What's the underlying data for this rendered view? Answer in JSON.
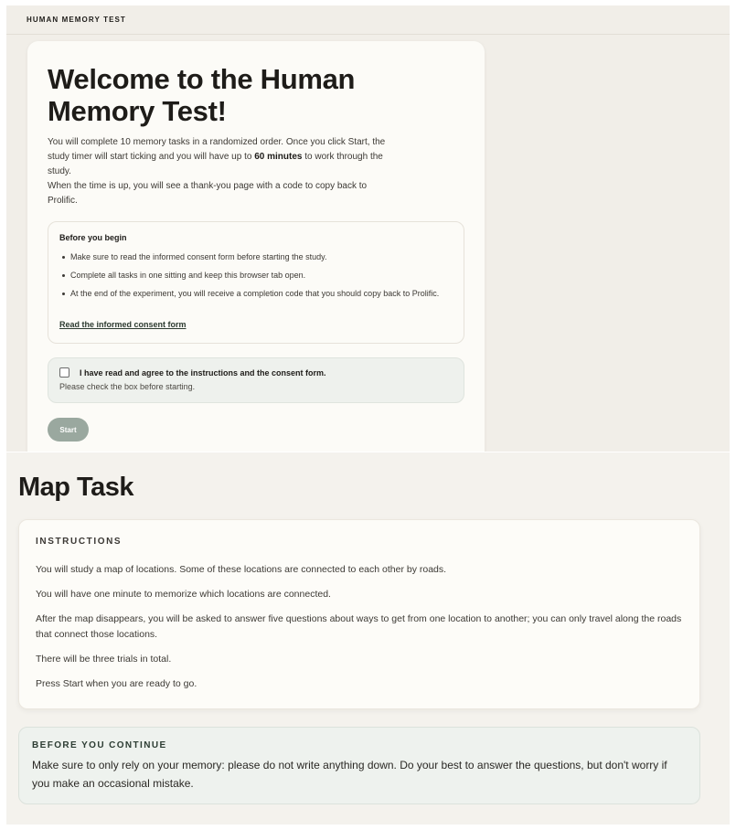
{
  "header": {
    "app_title": "HUMAN MEMORY TEST"
  },
  "welcome": {
    "title": "Welcome to the Human Memory Test!",
    "intro_line1_pre": "You will complete 10 memory tasks in a randomized order. Once you click Start, the study timer will start ticking and you will have up to ",
    "intro_line1_bold": "60 minutes",
    "intro_line1_post": " to work through the study.",
    "intro_line2": "When the time is up, you will see a thank-you page with a code to copy back to Prolific.",
    "before_begin": {
      "heading": "Before you begin",
      "items": [
        "Make sure to read the informed consent form before starting the study.",
        "Complete all tasks in one sitting and keep this browser tab open.",
        "At the end of the experiment, you will receive a completion code that you should copy back to Prolific."
      ],
      "link": "Read the informed consent form"
    },
    "agreement": {
      "label": "I have read and agree to the instructions and the consent form.",
      "hint": "Please check the box before starting.",
      "checked": false
    },
    "start_button": "Start",
    "start_button_color": "#9aa89f"
  },
  "map_task": {
    "title": "Map Task",
    "instructions": {
      "heading": "INSTRUCTIONS",
      "paragraphs": [
        "You will study a map of locations. Some of these locations are connected to each other by roads.",
        "You will have one minute to memorize which locations are connected.",
        "After the map disappears, you will be asked to answer five questions about ways to get from one location to another; you can only travel along the roads that connect those locations.",
        "There will be three trials in total.",
        "Press Start when you are ready to go."
      ]
    },
    "before_continue": {
      "heading": "BEFORE YOU CONTINUE",
      "text": "Make sure to only rely on your memory: please do not write anything down. Do your best to answer the questions, but don't worry if you make an occasional mistake."
    }
  }
}
